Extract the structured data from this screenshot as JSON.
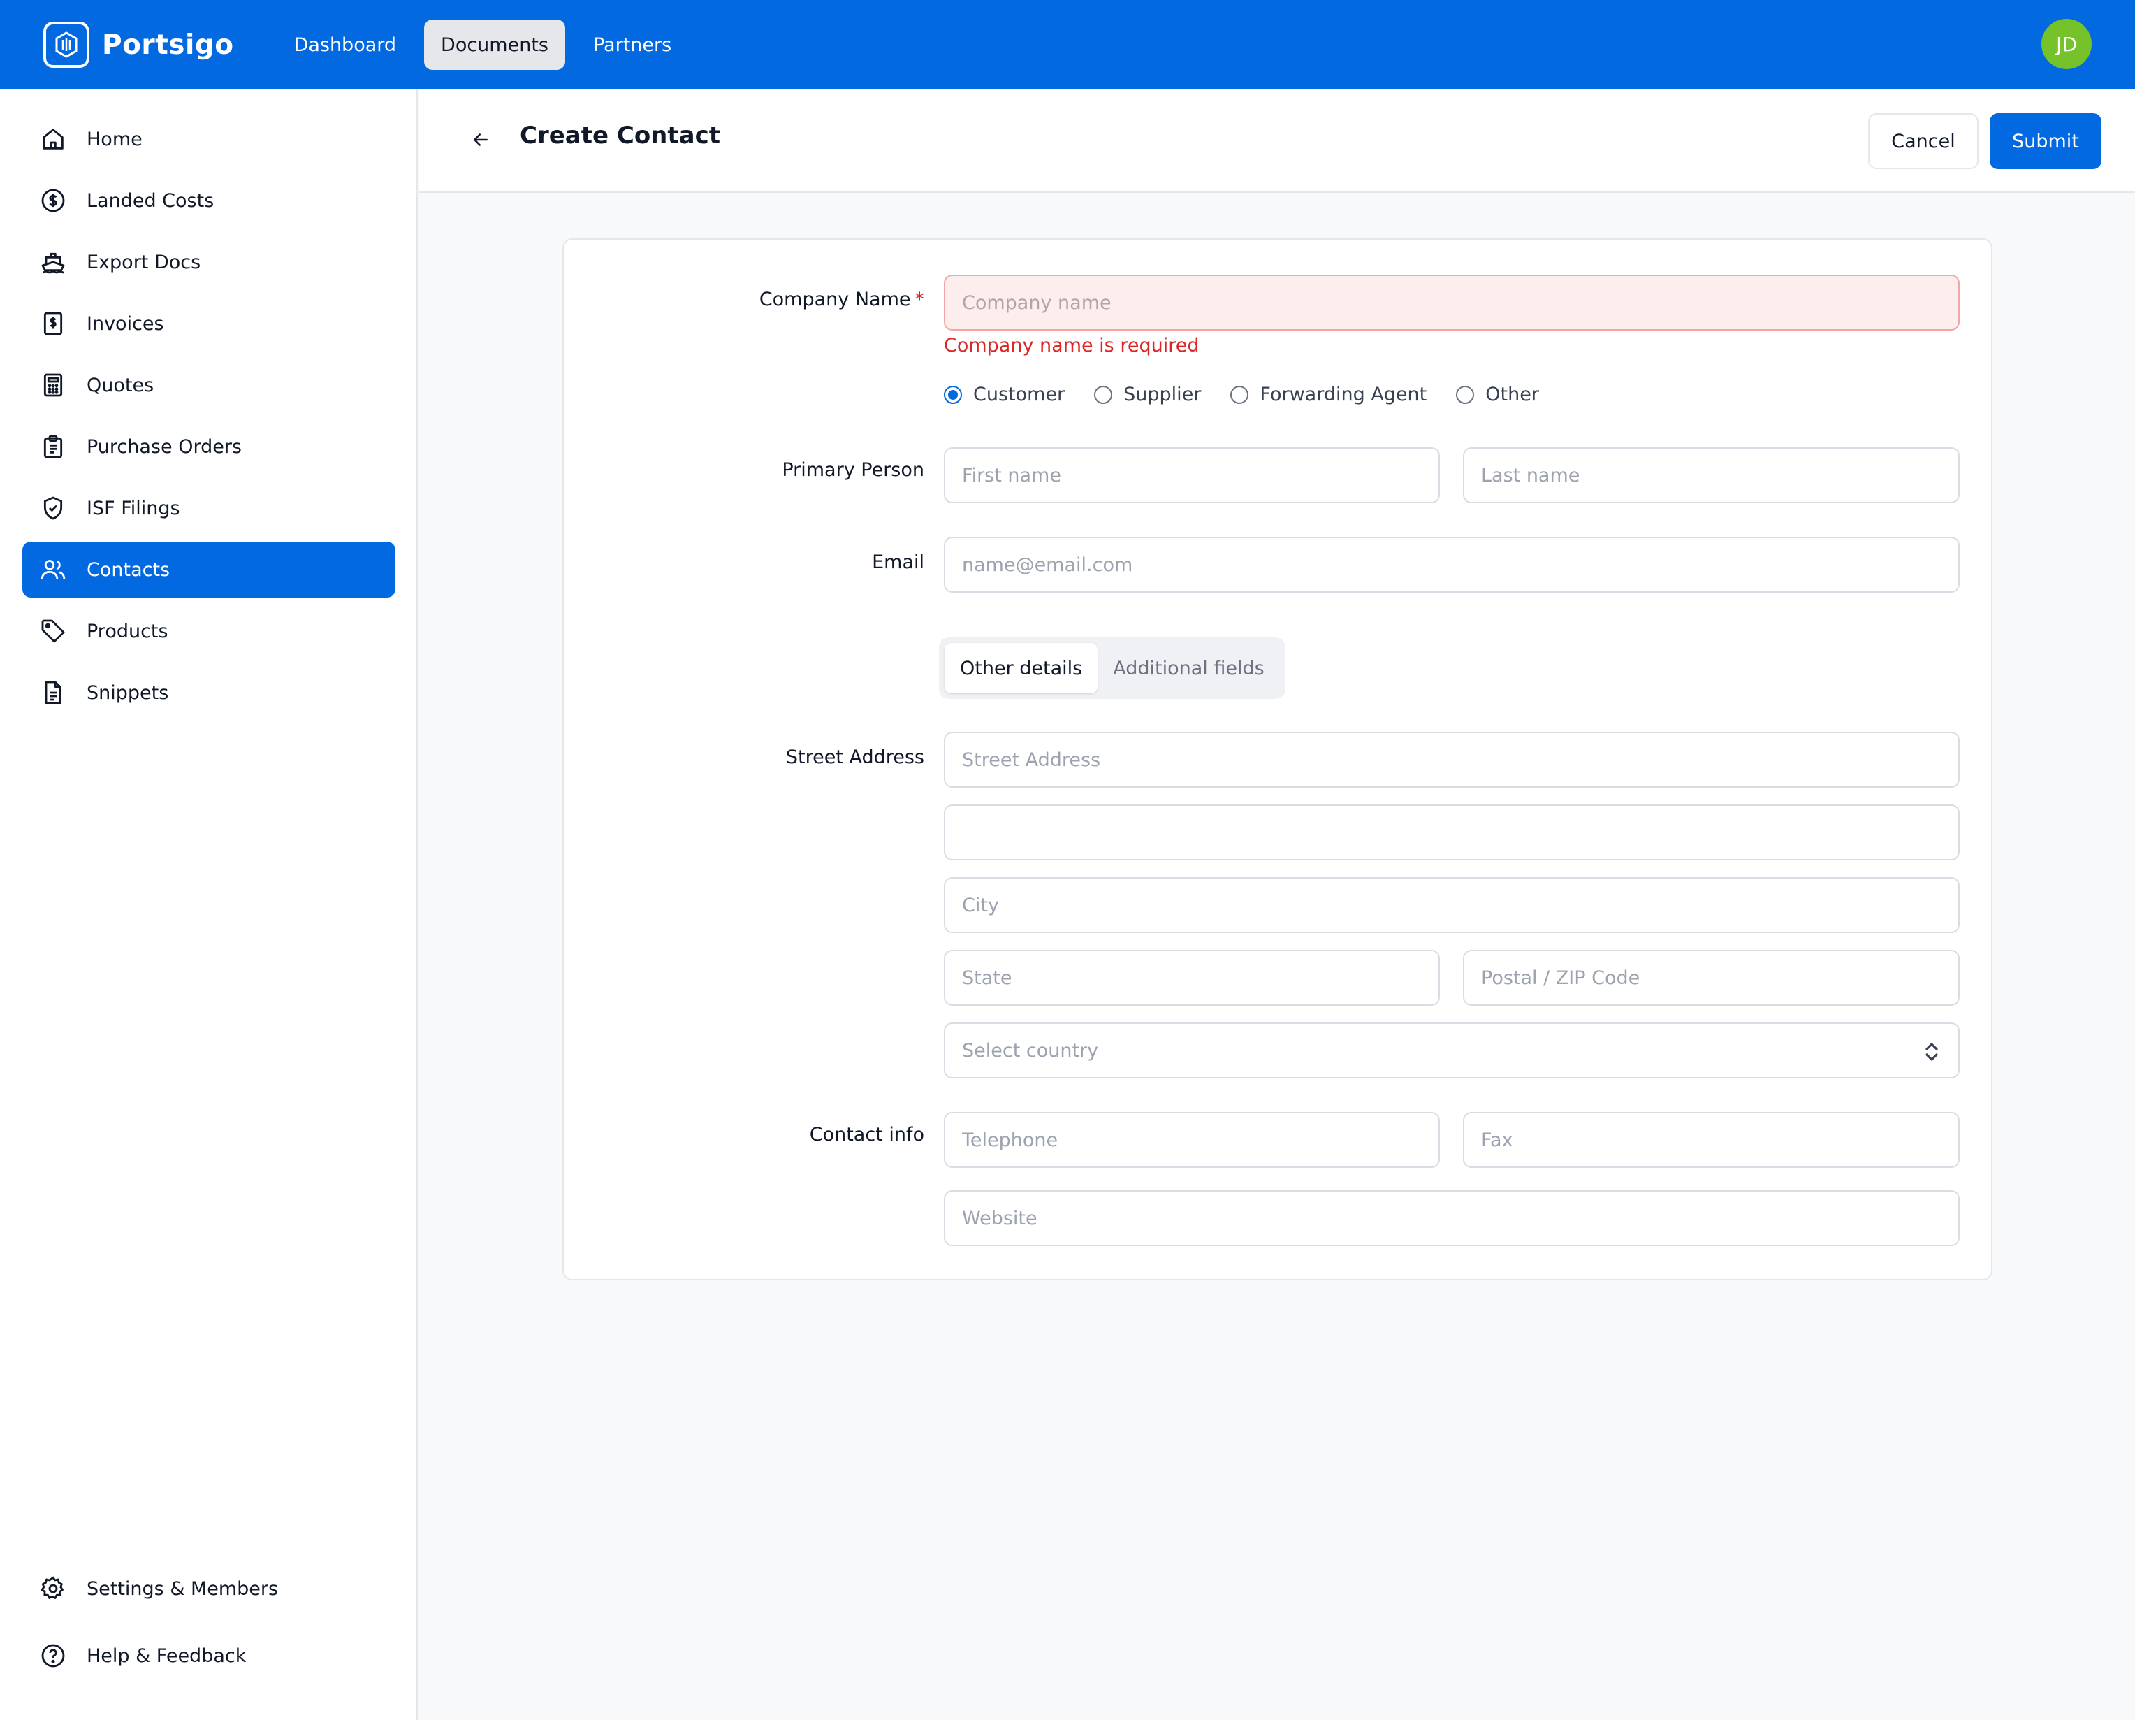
{
  "brand": {
    "name": "Portsigo"
  },
  "topnav": [
    {
      "label": "Dashboard",
      "active": false
    },
    {
      "label": "Documents",
      "active": true
    },
    {
      "label": "Partners",
      "active": false
    }
  ],
  "user": {
    "initials": "JD"
  },
  "sidebar": {
    "items": [
      {
        "label": "Home",
        "icon": "home-icon"
      },
      {
        "label": "Landed Costs",
        "icon": "dollar-circle-icon"
      },
      {
        "label": "Export Docs",
        "icon": "ship-icon"
      },
      {
        "label": "Invoices",
        "icon": "invoice-icon"
      },
      {
        "label": "Quotes",
        "icon": "calculator-icon"
      },
      {
        "label": "Purchase Orders",
        "icon": "clipboard-icon"
      },
      {
        "label": "ISF Filings",
        "icon": "shield-check-icon"
      },
      {
        "label": "Contacts",
        "icon": "users-icon",
        "active": true
      },
      {
        "label": "Products",
        "icon": "tag-icon"
      },
      {
        "label": "Snippets",
        "icon": "document-icon"
      }
    ],
    "footer": [
      {
        "label": "Settings & Members",
        "icon": "gear-icon"
      },
      {
        "label": "Help & Feedback",
        "icon": "help-circle-icon"
      }
    ]
  },
  "header": {
    "title": "Create Contact",
    "cancel_label": "Cancel",
    "submit_label": "Submit"
  },
  "form": {
    "company_name": {
      "label": "Company Name",
      "required_mark": "*",
      "placeholder": "Company name",
      "value": "",
      "error": "Company name is required"
    },
    "contact_type": {
      "options": [
        "Customer",
        "Supplier",
        "Forwarding Agent",
        "Other"
      ],
      "selected": "Customer"
    },
    "primary_person": {
      "label": "Primary Person",
      "first_placeholder": "First name",
      "last_placeholder": "Last name"
    },
    "email": {
      "label": "Email",
      "placeholder": "name@email.com"
    },
    "tabs": [
      {
        "label": "Other details",
        "active": true
      },
      {
        "label": "Additional fields",
        "active": false
      }
    ],
    "address": {
      "label": "Street Address",
      "street_placeholder": "Street Address",
      "street2_placeholder": "",
      "city_placeholder": "City",
      "state_placeholder": "State",
      "zip_placeholder": "Postal / ZIP Code",
      "country_placeholder": "Select country"
    },
    "contact_info": {
      "label": "Contact info",
      "telephone_placeholder": "Telephone",
      "fax_placeholder": "Fax",
      "website_placeholder": "Website"
    }
  },
  "colors": {
    "brand_blue": "#0369e0",
    "avatar_green": "#76c22b",
    "error_red": "#dc2626"
  }
}
